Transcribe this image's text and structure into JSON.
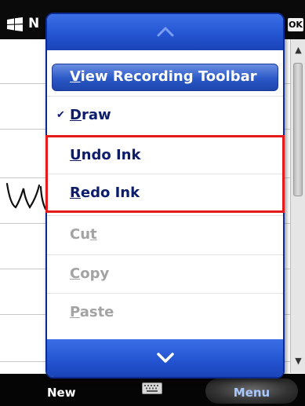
{
  "titlebar": {
    "title_visible_part": "N",
    "ok_label": "OK"
  },
  "menu": {
    "items": [
      {
        "label_accel": "V",
        "label_rest": "iew Recording Toolbar",
        "state": "highlighted"
      },
      {
        "label_accel": "D",
        "label_rest": "raw",
        "state": "checked"
      },
      {
        "label_accel": "U",
        "label_rest": "ndo Ink",
        "state": "enabled"
      },
      {
        "label_accel": "R",
        "label_rest": "edo Ink",
        "state": "enabled"
      },
      {
        "label_pre": "Cu",
        "label_accel": "t",
        "state": "disabled"
      },
      {
        "label_accel": "C",
        "label_rest": "opy",
        "state": "disabled"
      },
      {
        "label_accel": "P",
        "label_rest": "aste",
        "state": "disabled"
      }
    ],
    "check_glyph": "✔"
  },
  "softkeys": {
    "left": "New",
    "right": "Menu"
  },
  "colors": {
    "menu_accent": "#2455d2",
    "menu_text": "#0d1c6b",
    "disabled_text": "#a3a3a3",
    "annotation": "#e51a1a",
    "softkey_right_text": "#a8c8ff"
  },
  "icons": {
    "start": "windows-flag-icon",
    "scroll_up": "scroll-up-arrow-icon",
    "menu_up": "chevron-up-icon",
    "menu_down": "chevron-down-icon",
    "keyboard": "keyboard-icon"
  }
}
